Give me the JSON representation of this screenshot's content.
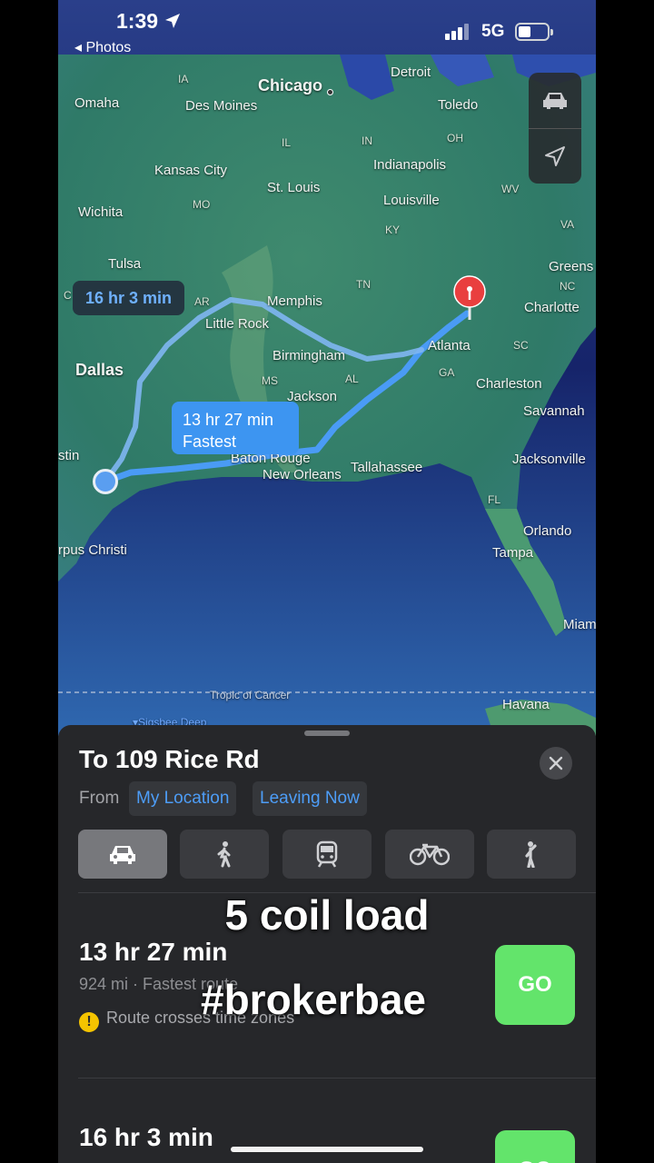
{
  "status_bar": {
    "time": "1:39",
    "back_label": "Photos",
    "network": "5G"
  },
  "map": {
    "cities": {
      "chicago": "Chicago",
      "detroit": "Detroit",
      "toledo": "Toledo",
      "des_moines": "Des Moines",
      "omaha": "Omaha",
      "indianapolis": "Indianapolis",
      "kansas_city": "Kansas City",
      "st_louis": "St. Louis",
      "louisville": "Louisville",
      "wichita": "Wichita",
      "tulsa": "Tulsa",
      "memphis": "Memphis",
      "little_rock": "Little Rock",
      "greensboro": "Greens",
      "charlotte": "Charlotte",
      "dallas": "Dallas",
      "birmingham": "Birmingham",
      "atlanta": "Atlanta",
      "jackson": "Jackson",
      "charleston": "Charleston",
      "savannah": "Savannah",
      "baton_rouge": "Baton Rouge",
      "new_orleans": "New Orleans",
      "tallahassee": "Tallahassee",
      "jacksonville": "Jacksonville",
      "austin": "stin",
      "corpus_christi": "rpus Christi",
      "orlando": "Orlando",
      "tampa": "Tampa",
      "miami": "Miam",
      "havana": "Havana"
    },
    "states": {
      "ia": "IA",
      "il": "IL",
      "in": "IN",
      "oh": "OH",
      "mo": "MO",
      "ky": "KY",
      "wv": "WV",
      "va": "VA",
      "tn": "TN",
      "nc": "NC",
      "ar": "AR",
      "sc": "SC",
      "ms": "MS",
      "al": "AL",
      "ga": "GA",
      "fl": "FL",
      "ok": "C"
    },
    "other_labels": {
      "tropic": "Tropic of Cancer",
      "deep": "▾Sigsbee Deep"
    },
    "callout_alt": "16 hr 3 min",
    "callout_fast_time": "13 hr 27 min",
    "callout_fast_label": "Fastest",
    "route_color": "#4a9bf5",
    "alt_route_color": "#7fb6f2"
  },
  "sheet": {
    "destination": "To 109 Rice Rd",
    "from_label": "From",
    "from_chip": "My Location",
    "time_chip": "Leaving Now",
    "modes": [
      "car-icon",
      "walk-icon",
      "transit-icon",
      "bike-icon",
      "rideshare-icon"
    ],
    "routes": [
      {
        "time": "13 hr 27 min",
        "subtitle": "924 mi · Fastest route",
        "warning": "Route crosses time zones",
        "go": "GO"
      },
      {
        "time": "16 hr 3 min",
        "go": "GO"
      }
    ]
  },
  "overlay": {
    "line1": "5 coil load",
    "line2": "#brokerbae"
  },
  "colors": {
    "accent": "#4d9df7",
    "go": "#63e46b",
    "sheet_bg": "#26272a"
  }
}
